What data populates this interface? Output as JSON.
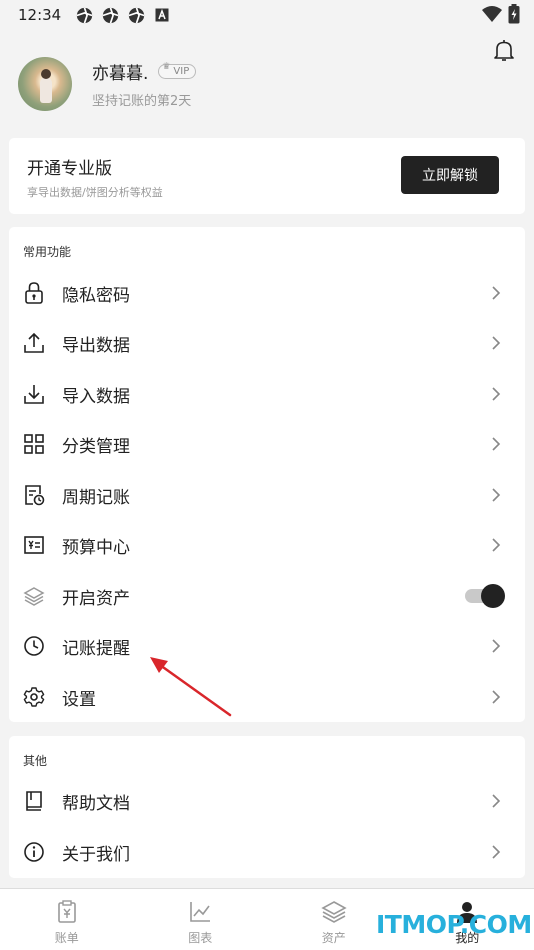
{
  "status_bar": {
    "time": "12:34",
    "icons": [
      "aperture-icon",
      "aperture-icon",
      "aperture-icon",
      "a-box-icon"
    ],
    "right_icons": [
      "wifi-icon",
      "battery-charging-icon"
    ]
  },
  "profile": {
    "username": "亦暮暮.",
    "badge": "VIP",
    "streak": "坚持记账的第2天"
  },
  "pro": {
    "title": "开通专业版",
    "subtitle": "享导出数据/饼图分析等权益",
    "button": "立即解锁"
  },
  "common": {
    "title": "常用功能",
    "items": [
      {
        "label": "隐私密码",
        "icon": "lock-icon"
      },
      {
        "label": "导出数据",
        "icon": "upload-icon"
      },
      {
        "label": "导入数据",
        "icon": "download-icon"
      },
      {
        "label": "分类管理",
        "icon": "grid-icon"
      },
      {
        "label": "周期记账",
        "icon": "recurring-doc-icon"
      },
      {
        "label": "预算中心",
        "icon": "yen-card-icon"
      },
      {
        "label": "开启资产",
        "icon": "layers-icon",
        "toggle": true
      },
      {
        "label": "记账提醒",
        "icon": "clock-icon"
      },
      {
        "label": "设置",
        "icon": "gear-icon"
      }
    ]
  },
  "other": {
    "title": "其他",
    "items": [
      {
        "label": "帮助文档",
        "icon": "book-icon"
      },
      {
        "label": "关于我们",
        "icon": "info-icon"
      }
    ]
  },
  "tabs": [
    {
      "label": "账单",
      "icon": "bill-icon"
    },
    {
      "label": "图表",
      "icon": "chart-icon"
    },
    {
      "label": "资产",
      "icon": "layers-icon"
    },
    {
      "label": "我的",
      "icon": "person-icon",
      "active": true
    }
  ],
  "watermark": "ITMOP.COM",
  "colors": {
    "accent": "#222222",
    "watermark": "#27b0dc",
    "annotation": "#d9262b"
  }
}
